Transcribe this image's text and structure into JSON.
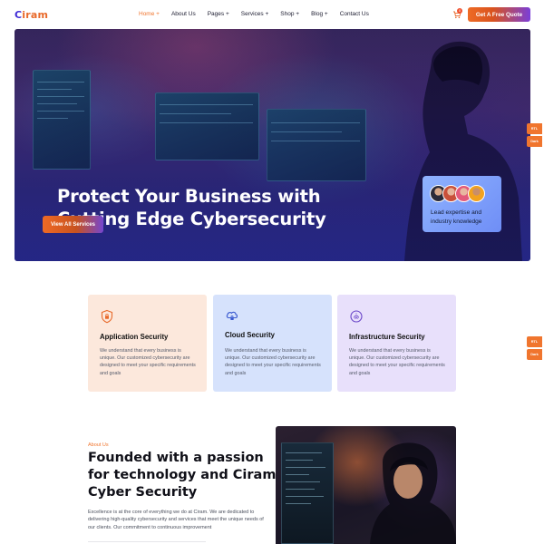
{
  "brand": {
    "name_first": "C",
    "name_rest": "iram"
  },
  "nav": {
    "items": [
      {
        "label": "Home +"
      },
      {
        "label": "About Us"
      },
      {
        "label": "Pages +"
      },
      {
        "label": "Services +"
      },
      {
        "label": "Shop +"
      },
      {
        "label": "Blog +"
      },
      {
        "label": "Contact Us"
      }
    ],
    "cart_count": "0",
    "quote_label": "Get A Free Quote"
  },
  "hero": {
    "title_line1": "Protect Your Business with",
    "title_line2": "Cutting Edge Cybersecurity",
    "button_label": "View All Services",
    "expert_text_line1": "Lead expertise and",
    "expert_text_line2": "industry knowledge"
  },
  "side_toggles": [
    {
      "label": "RTL"
    },
    {
      "label": "Dark"
    },
    {
      "label": "RTL"
    },
    {
      "label": "Dark"
    }
  ],
  "services": [
    {
      "title": "Application Security",
      "text": "We understand that every business is unique. Our customized cybersecurity are designed to meet your specific requirements and goals",
      "icon": "shield-lock-icon",
      "bg": "#fce8dc"
    },
    {
      "title": "Cloud Security",
      "text": "We understand that every business is unique. Our customized cybersecurity are designed to meet your specific requirements and goals",
      "icon": "cloud-lock-icon",
      "bg": "#d6e2fc"
    },
    {
      "title": "Infrastructure Security",
      "text": "We understand that every business is unique. Our customized cybersecurity are designed to meet your specific requirements and goals",
      "icon": "fingerprint-icon",
      "bg": "#e8e0fb"
    }
  ],
  "about": {
    "kicker": "About Us",
    "title": "Founded with a passion for technology and Ciram Cyber Security",
    "text": "Excellence is at the core of everything we do at Ciram. We are dedicated to delivering high-quality cybersecurity and services that meet the unique needs of our clients. Our commitment to continuous improvement"
  },
  "colors": {
    "accent": "#f0752e",
    "brand_blue": "#3f2bd6",
    "gradient_end": "#7a3fd8"
  }
}
